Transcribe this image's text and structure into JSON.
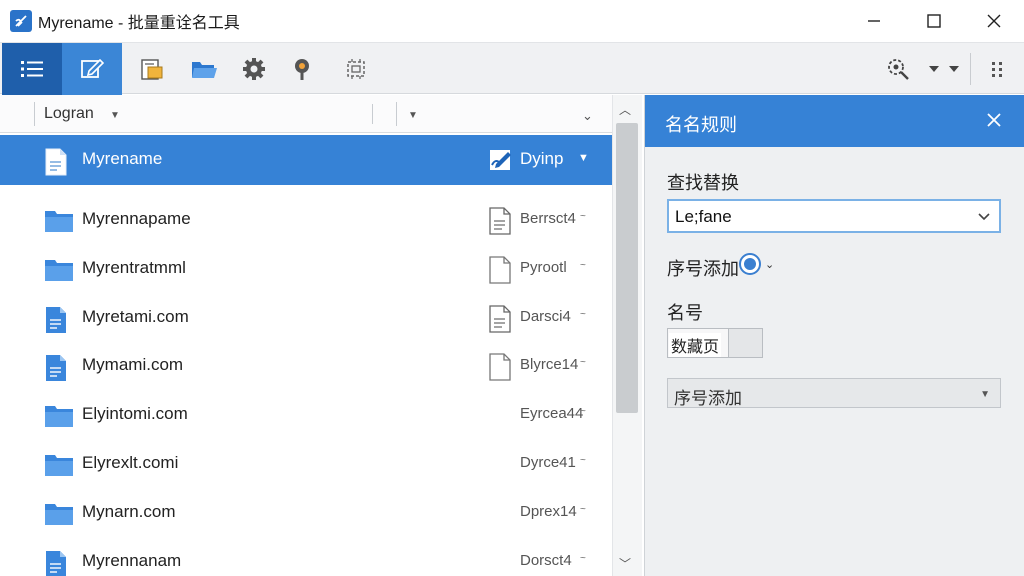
{
  "window": {
    "title": "Myrename - 批量重诠名工具",
    "icon": "app-logo-icon"
  },
  "toolbar": {
    "buttons": [
      {
        "name": "list-view-icon"
      },
      {
        "name": "edit-icon"
      },
      {
        "name": "document-folder-icon"
      },
      {
        "name": "open-folder-icon"
      },
      {
        "name": "settings-gear-icon"
      },
      {
        "name": "pin-icon"
      },
      {
        "name": "plugin-icon"
      },
      {
        "name": "search-settings-icon"
      }
    ]
  },
  "file_list": {
    "column_header": "Logran",
    "rows": [
      {
        "name": "Myrename",
        "type": "Dyinp",
        "kind": "document",
        "selected": true
      },
      {
        "name": "Myrennapame",
        "type": "Berrsct4",
        "kind": "folder"
      },
      {
        "name": "Myrentratmml",
        "type": "Pyrootl",
        "kind": "folder"
      },
      {
        "name": "Myretami.com",
        "type": "Darsci4",
        "kind": "document"
      },
      {
        "name": "Mymami.com",
        "type": "Blyrce14",
        "kind": "document"
      },
      {
        "name": "Elyintomi.com",
        "type": "Eyrcea44",
        "kind": "folder"
      },
      {
        "name": "Elyrexlt.comi",
        "type": "Dyrce41",
        "kind": "folder"
      },
      {
        "name": "Mynarn.com",
        "type": "Dprex14",
        "kind": "folder"
      },
      {
        "name": "Myrennanam",
        "type": "Dorsct4",
        "kind": "document"
      }
    ]
  },
  "right_panel": {
    "title": "名名规则",
    "find_replace_label": "查找替换",
    "find_replace_value": "Le;fane",
    "sequence_label": "序号添加",
    "name_label": "名号",
    "name_value": "数藏页",
    "select_value": "序号添加"
  },
  "colors": {
    "accent": "#3682d6",
    "accent_dark": "#1f5fab",
    "folder": "#4a93e0",
    "panel_bg": "#eef0f2"
  }
}
